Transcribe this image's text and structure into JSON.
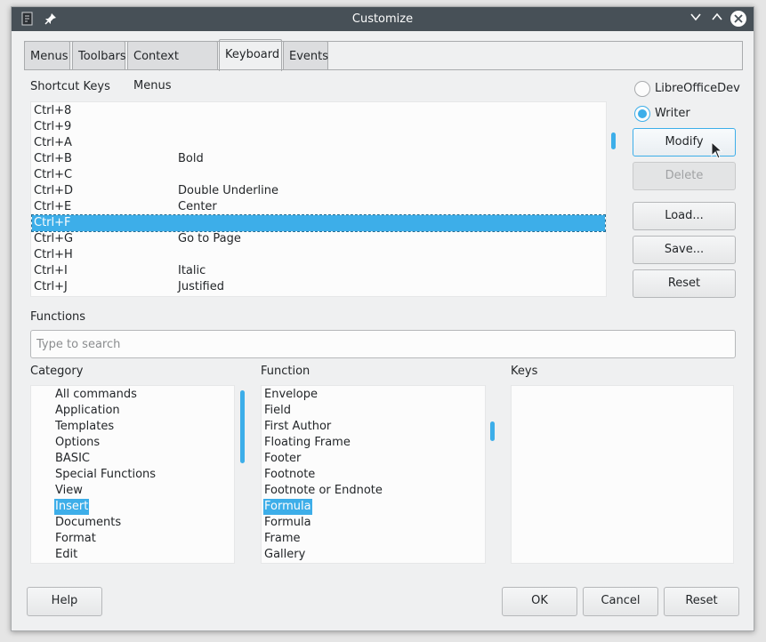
{
  "window": {
    "title": "Customize"
  },
  "tabs": [
    {
      "label": "Menus"
    },
    {
      "label": "Toolbars"
    },
    {
      "label": "Context Menus"
    },
    {
      "label": "Keyboard"
    },
    {
      "label": "Events"
    }
  ],
  "shortcut": {
    "label": "Shortcut Keys",
    "rows": [
      {
        "key": "Ctrl+8",
        "func": ""
      },
      {
        "key": "Ctrl+9",
        "func": ""
      },
      {
        "key": "Ctrl+A",
        "func": ""
      },
      {
        "key": "Ctrl+B",
        "func": "Bold"
      },
      {
        "key": "Ctrl+C",
        "func": ""
      },
      {
        "key": "Ctrl+D",
        "func": "Double Underline"
      },
      {
        "key": "Ctrl+E",
        "func": "Center"
      },
      {
        "key": "Ctrl+F",
        "func": ""
      },
      {
        "key": "Ctrl+G",
        "func": "Go to Page"
      },
      {
        "key": "Ctrl+H",
        "func": ""
      },
      {
        "key": "Ctrl+I",
        "func": "Italic"
      },
      {
        "key": "Ctrl+J",
        "func": "Justified"
      }
    ],
    "selected": "Ctrl+F"
  },
  "scope": {
    "options": [
      "LibreOfficeDev",
      "Writer"
    ],
    "selected": "Writer"
  },
  "side_buttons": {
    "modify": "Modify",
    "delete": "Delete",
    "load": "Load...",
    "save": "Save...",
    "reset": "Reset"
  },
  "functions": {
    "label": "Functions",
    "search_placeholder": "Type to search",
    "category_label": "Category",
    "function_label": "Function",
    "keys_label": "Keys",
    "categories": [
      "All commands",
      "Application",
      "Templates",
      "Options",
      "BASIC",
      "Special Functions",
      "View",
      "Insert",
      "Documents",
      "Format",
      "Edit"
    ],
    "selected_category": "Insert",
    "function_items": [
      "Envelope",
      "Field",
      "First Author",
      "Floating Frame",
      "Footer",
      "Footnote",
      "Footnote or Endnote",
      "Formula",
      "Formula",
      "Frame",
      "Gallery"
    ],
    "selected_function_index": 7
  },
  "footer": {
    "help": "Help",
    "ok": "OK",
    "cancel": "Cancel",
    "reset": "Reset"
  },
  "colors": {
    "accent": "#3daee9",
    "titlebar": "#475057"
  }
}
